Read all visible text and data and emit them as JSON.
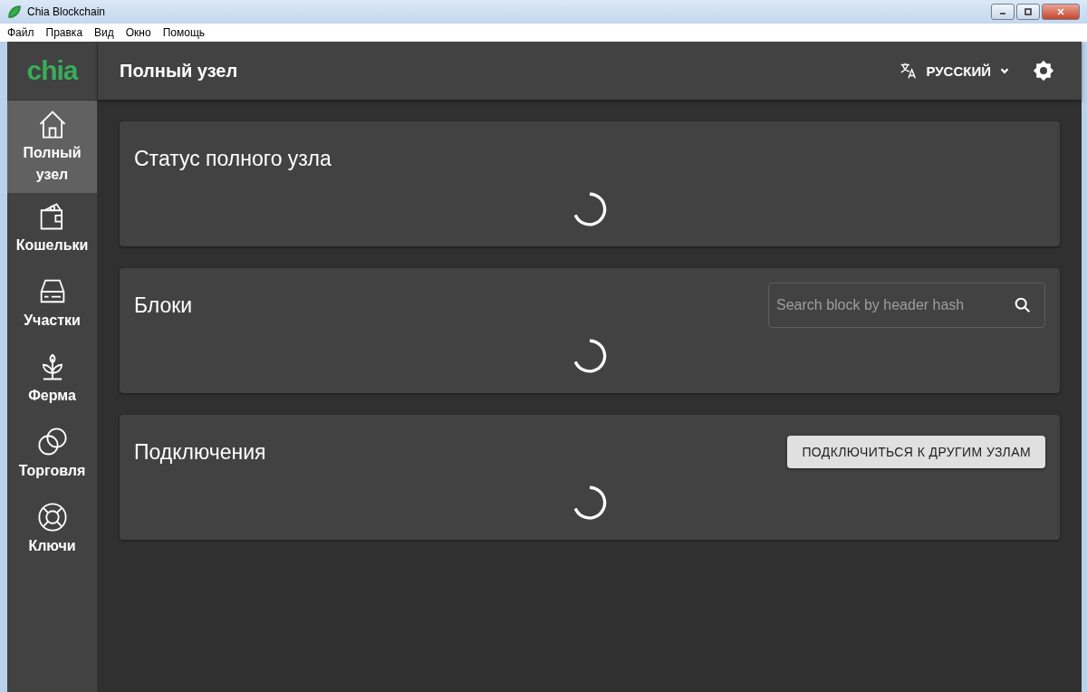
{
  "window": {
    "title": "Chia Blockchain"
  },
  "menu": [
    "Файл",
    "Правка",
    "Вид",
    "Окно",
    "Помощь"
  ],
  "logo": "chia",
  "header": {
    "title": "Полный узел",
    "language": "РУССКИЙ"
  },
  "sidebar": {
    "items": [
      {
        "label": "Полный узел",
        "selected": true
      },
      {
        "label": "Кошельки",
        "selected": false
      },
      {
        "label": "Участки",
        "selected": false
      },
      {
        "label": "Ферма",
        "selected": false
      },
      {
        "label": "Торговля",
        "selected": false
      },
      {
        "label": "Ключи",
        "selected": false
      }
    ]
  },
  "cards": [
    {
      "kind": "plain",
      "title": "Статус полного узла"
    },
    {
      "kind": "search",
      "title": "Блоки",
      "placeholder": "Search block by header hash"
    },
    {
      "kind": "button",
      "title": "Подключения",
      "button": "ПОДКЛЮЧИТЬСЯ К ДРУГИМ УЗЛАМ"
    }
  ]
}
